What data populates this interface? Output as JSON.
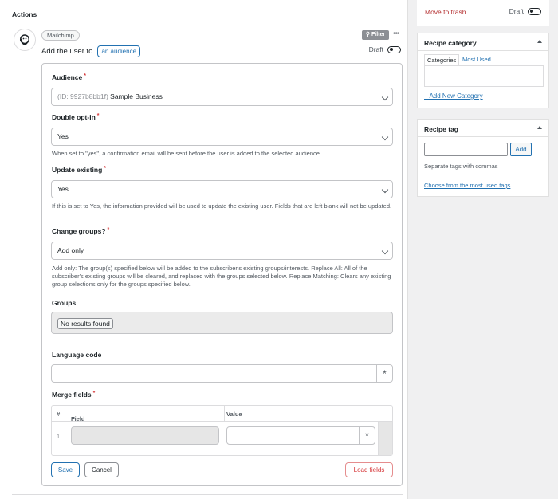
{
  "actions": {
    "title": "Actions",
    "integration": "Mailchimp",
    "sentence_prefix": "Add the user to",
    "sentence_token": "an audience",
    "filter_label": "Filter",
    "status_label": "Draft"
  },
  "form": {
    "audience": {
      "label": "Audience",
      "required": "*",
      "id_text": "(ID: 9927b8bb1f)",
      "value": "Sample Business"
    },
    "double_opt_in": {
      "label": "Double opt-in",
      "required": "*",
      "value": "Yes",
      "help": "When set to \"yes\", a confirmation email will be sent before the user is added to the selected audience."
    },
    "update_existing": {
      "label": "Update existing",
      "required": "*",
      "value": "Yes",
      "help": "If this is set to Yes, the information provided will be used to update the existing user. Fields that are left blank will not be updated."
    },
    "change_groups": {
      "label": "Change groups?",
      "required": "*",
      "value": "Add only",
      "help": "Add only: The group(s) specified below will be added to the subscriber's existing groups/interests. Replace All: All of the subscriber's existing groups will be cleared, and replaced with the groups selected below. Replace Matching: Clears any existing group selections only for the groups specified below."
    },
    "groups": {
      "label": "Groups",
      "chip": "No results found"
    },
    "language_code": {
      "label": "Language code",
      "value": "",
      "token_symbol": "*"
    },
    "merge_fields": {
      "label": "Merge fields",
      "required": "*",
      "columns": [
        "#",
        "Field",
        "Value"
      ],
      "field_required": "*",
      "rows": [
        {
          "num": "1",
          "field": "",
          "value": ""
        }
      ],
      "token_symbol": "*"
    },
    "buttons": {
      "save": "Save",
      "cancel": "Cancel",
      "load_fields": "Load fields"
    }
  },
  "sidebar": {
    "trash_label": "Move to trash",
    "status_label": "Draft",
    "category": {
      "title": "Recipe category",
      "tabs": [
        "Categories",
        "Most Used"
      ],
      "add_link": "+ Add New Category"
    },
    "tag": {
      "title": "Recipe tag",
      "input_value": "",
      "add_button": "Add",
      "help": "Separate tags with commas",
      "choose_link": "Choose from the most used tags"
    }
  },
  "colors": {
    "link": "#2271b1",
    "danger": "#d63638",
    "filter_bg": "#8c8f94"
  }
}
